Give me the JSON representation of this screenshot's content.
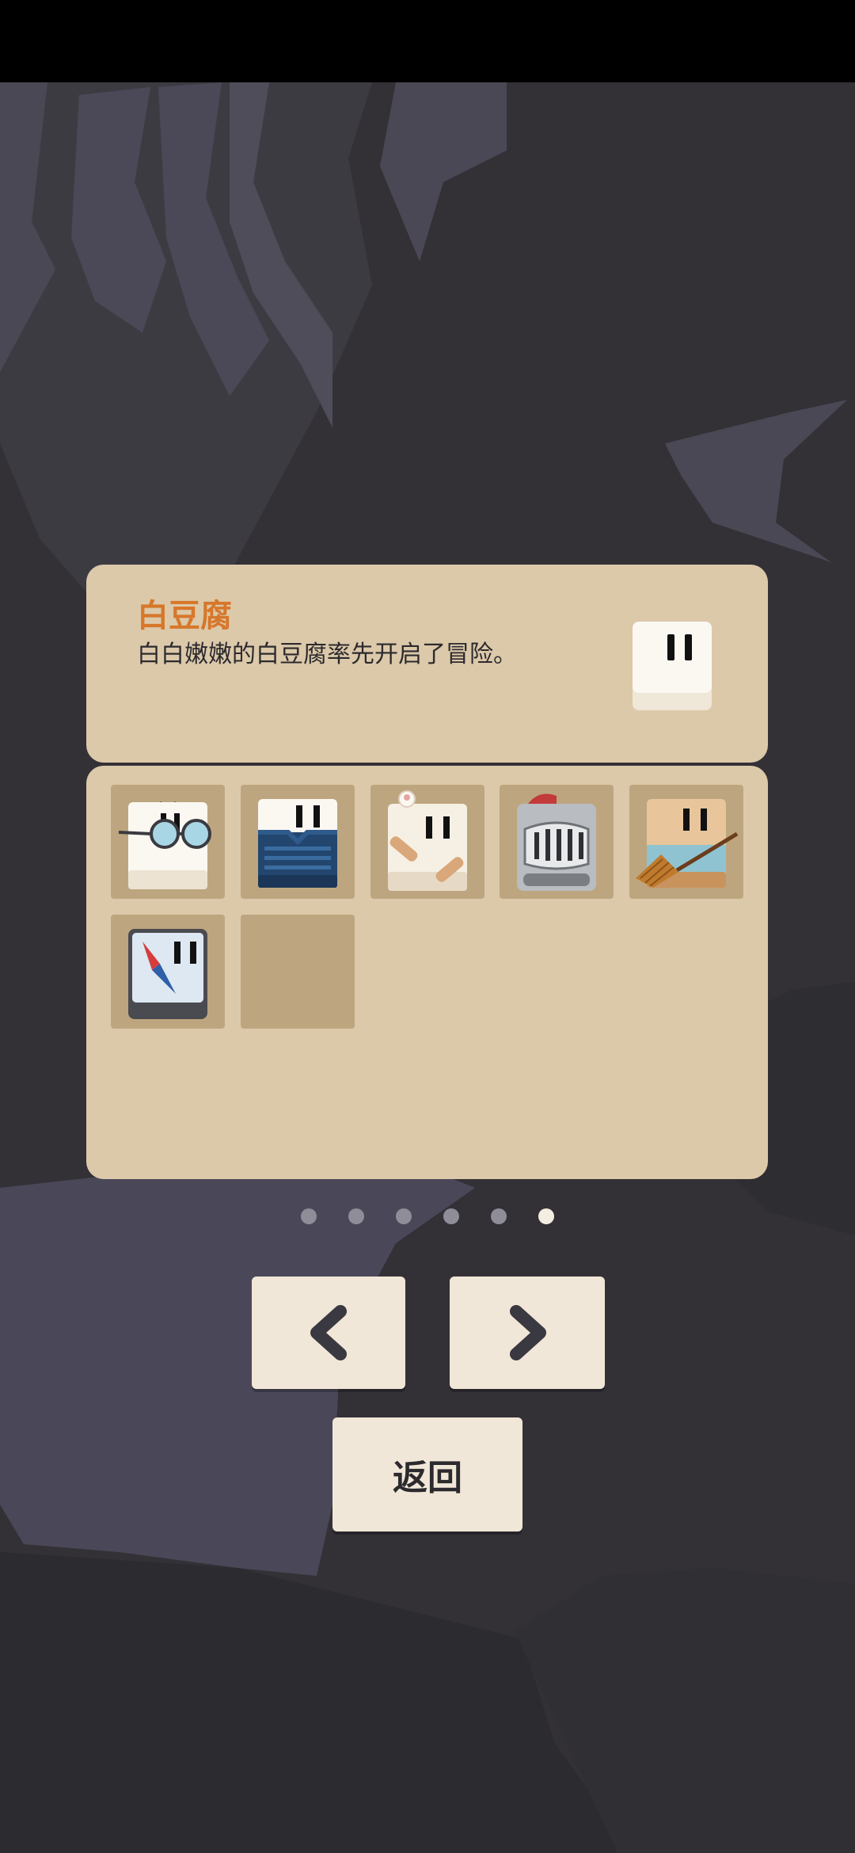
{
  "character": {
    "name": "白豆腐",
    "description": "白白嫩嫩的白豆腐率先开启了冒险。"
  },
  "skins": [
    {
      "icon": "glasses-tofu-icon",
      "locked": false
    },
    {
      "icon": "sweater-tofu-icon",
      "locked": false
    },
    {
      "icon": "bandaged-tofu-icon",
      "locked": false
    },
    {
      "icon": "knight-helmet-tofu-icon",
      "locked": false
    },
    {
      "icon": "broom-tofu-icon",
      "locked": false
    },
    {
      "icon": "compass-tofu-icon",
      "locked": false
    },
    {
      "icon": "empty-slot",
      "locked": true
    }
  ],
  "pagination": {
    "total": 6,
    "current": 6
  },
  "buttons": {
    "prev_icon": "chevron-left-icon",
    "next_icon": "chevron-right-icon",
    "back_label": "返回"
  },
  "colors": {
    "panel": "#dcc9aa",
    "slot": "#bda67f",
    "name": "#d7772a",
    "button": "#f1e7d8",
    "background": "#333136"
  }
}
